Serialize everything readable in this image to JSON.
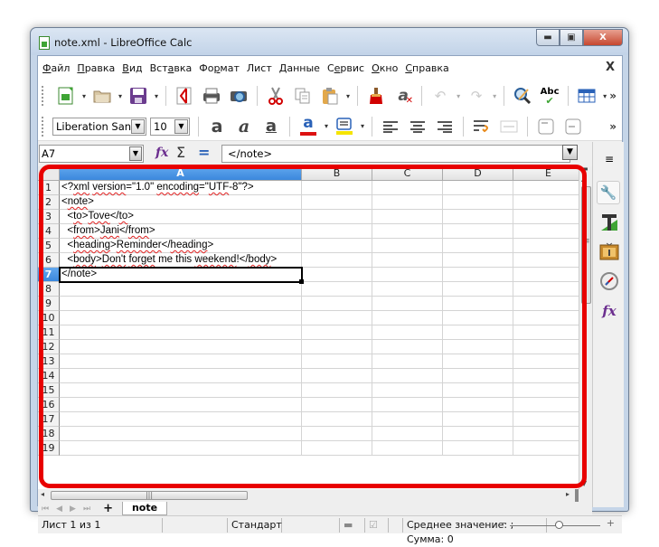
{
  "window": {
    "title": "note.xml - LibreOffice Calc",
    "controls": {
      "minimize": "▭",
      "maximize": "▣",
      "close": "X"
    }
  },
  "menubar": {
    "items": [
      {
        "label": "Файл",
        "underline": "Ф",
        "rest": "айл"
      },
      {
        "label": "Правка",
        "underline": "П",
        "rest": "равка"
      },
      {
        "label": "Вид",
        "underline": "В",
        "rest": "ид"
      },
      {
        "label": "Вставка",
        "pre": "Вст",
        "underline": "а",
        "rest": "вка"
      },
      {
        "label": "Формат",
        "pre": "Фо",
        "underline": "р",
        "rest": "мат"
      },
      {
        "label": "Лист",
        "pre": "",
        "underline": "",
        "rest": "Лист"
      },
      {
        "label": "Данные",
        "underline": "Д",
        "rest": "анные"
      },
      {
        "label": "Сервис",
        "pre": "С",
        "underline": "е",
        "rest": "рвис"
      },
      {
        "label": "Окно",
        "underline": "О",
        "rest": "кно"
      },
      {
        "label": "Справка",
        "underline": "С",
        "rest": "правка"
      }
    ],
    "close_document": "X"
  },
  "toolbar_standard": {
    "icons": [
      "new-spreadsheet-icon",
      "open-folder-icon",
      "save-icon",
      "export-pdf-icon",
      "print-icon",
      "print-preview-icon",
      "cut-icon",
      "copy-icon",
      "paste-icon",
      "clone-formatting-icon",
      "clear-formatting-icon",
      "undo-icon",
      "redo-icon",
      "find-replace-icon",
      "spellcheck-icon",
      "insert-table-icon"
    ],
    "more": "»"
  },
  "toolbar_formatting": {
    "font_name": "Liberation Sans",
    "font_size": "10",
    "bold_glyph": "a",
    "italic_glyph": "a",
    "underline_glyph": "a",
    "font_color_glyph": "a",
    "font_color": "#dd1111",
    "highlight_color": "#f5e400",
    "more": "»"
  },
  "formula_bar": {
    "name_box": "A7",
    "fx": "fx",
    "sum": "Σ",
    "equals": "=",
    "content": "</note>"
  },
  "grid": {
    "columns": [
      "A",
      "B",
      "C",
      "D",
      "E"
    ],
    "selected_column": "A",
    "selected_row": 7,
    "active_cell": "A7",
    "rows": [
      {
        "n": "1",
        "a": "<?xml version=\"1.0\" encoding=\"UTF-8\"?>"
      },
      {
        "n": "2",
        "a": "<note>"
      },
      {
        "n": "3",
        "a": "  <to>Tove</to>"
      },
      {
        "n": "4",
        "a": "  <from>Jani</from>"
      },
      {
        "n": "5",
        "a": "  <heading>Reminder</heading>"
      },
      {
        "n": "6",
        "a": "  <body>Don't forget me this weekend!</body>"
      },
      {
        "n": "7",
        "a": "</note>"
      },
      {
        "n": "8",
        "a": ""
      },
      {
        "n": "9",
        "a": ""
      },
      {
        "n": "10",
        "a": ""
      },
      {
        "n": "11",
        "a": ""
      },
      {
        "n": "12",
        "a": ""
      },
      {
        "n": "13",
        "a": ""
      },
      {
        "n": "14",
        "a": ""
      },
      {
        "n": "15",
        "a": ""
      },
      {
        "n": "16",
        "a": ""
      },
      {
        "n": "17",
        "a": ""
      },
      {
        "n": "18",
        "a": ""
      },
      {
        "n": "19",
        "a": ""
      }
    ]
  },
  "sheet_tabs": {
    "add": "+",
    "tabs": [
      "note"
    ],
    "active": "note"
  },
  "statusbar": {
    "sheet_info": "Лист 1 из 1",
    "page_style": "Стандарт",
    "summary": "Среднее значение: ; Сумма: 0",
    "zoom_minus": "−",
    "zoom_plus": "+"
  },
  "sidebar": {
    "icons": [
      "sidebar-menu-icon",
      "properties-wrench-icon",
      "styles-icon",
      "gallery-icon",
      "navigator-icon",
      "functions-icon"
    ]
  },
  "annotation": {
    "frame_color": "#e80000"
  }
}
